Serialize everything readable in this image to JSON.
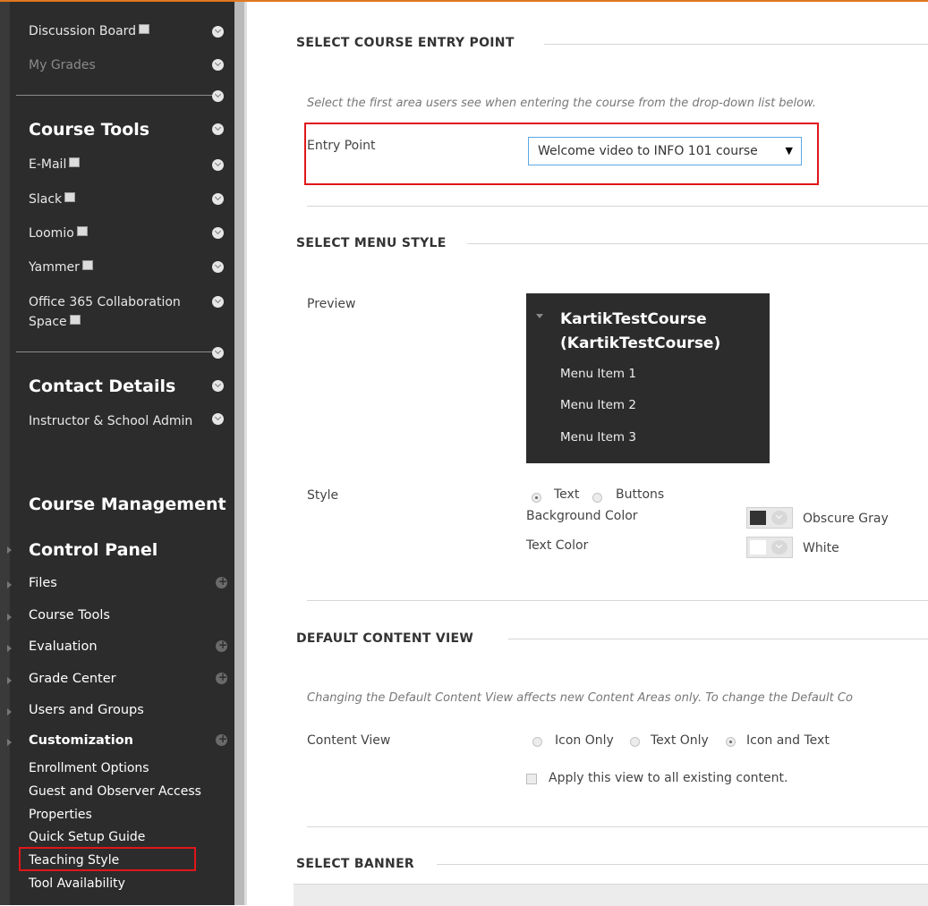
{
  "sidebar": {
    "items_top": [
      {
        "label": "Discussion Board",
        "ext": true,
        "dim": false
      },
      {
        "label": "My Grades",
        "ext": false,
        "dim": true
      }
    ],
    "course_tools_heading": "Course Tools",
    "course_tools": [
      {
        "label": "E-Mail"
      },
      {
        "label": "Slack"
      },
      {
        "label": "Loomio"
      },
      {
        "label": "Yammer"
      },
      {
        "label_line1": "Office 365 Collaboration",
        "label_line2": "Space"
      }
    ],
    "contact_heading": "Contact Details",
    "contact_item": "Instructor & School Admin",
    "management_heading": "Course Management",
    "control_panel_heading": "Control Panel",
    "control_panel_items": [
      "Files",
      "Course Tools",
      "Evaluation",
      "Grade Center",
      "Users and Groups",
      "Customization"
    ],
    "customization_subitems": [
      "Enrollment Options",
      "Guest and Observer Access",
      "Properties",
      "Quick Setup Guide",
      "Teaching Style",
      "Tool Availability"
    ]
  },
  "entry_point": {
    "title": "SELECT COURSE ENTRY POINT",
    "instruction": "Select the first area users see when entering the course from the drop-down list below.",
    "label": "Entry Point",
    "selected": "Welcome video to INFO 101 course"
  },
  "menu_style": {
    "title": "SELECT MENU STYLE",
    "preview_label": "Preview",
    "preview_title_line1": "KartikTestCourse",
    "preview_title_line2": "(KartikTestCourse)",
    "preview_items": [
      "Menu Item 1",
      "Menu Item 2",
      "Menu Item 3"
    ],
    "style_label": "Style",
    "style_options": [
      "Text",
      "Buttons"
    ],
    "style_selected": "Text",
    "bg_color_label": "Background Color",
    "bg_color_value": "Obscure Gray",
    "bg_color_hex": "#333333",
    "text_color_label": "Text Color",
    "text_color_value": "White",
    "text_color_hex": "#ffffff"
  },
  "content_view": {
    "title": "DEFAULT CONTENT VIEW",
    "instruction": "Changing the Default Content View affects new Content Areas only. To change the Default Co",
    "label": "Content View",
    "options": [
      "Icon Only",
      "Text Only",
      "Icon and Text"
    ],
    "selected": "Icon and Text",
    "apply_all_label": "Apply this view to all existing content."
  },
  "banner": {
    "title": "SELECT BANNER"
  },
  "colors": {
    "accent": "#e0781f",
    "highlight": "#e0161a",
    "sidebar_bg": "#2c2c2c"
  }
}
